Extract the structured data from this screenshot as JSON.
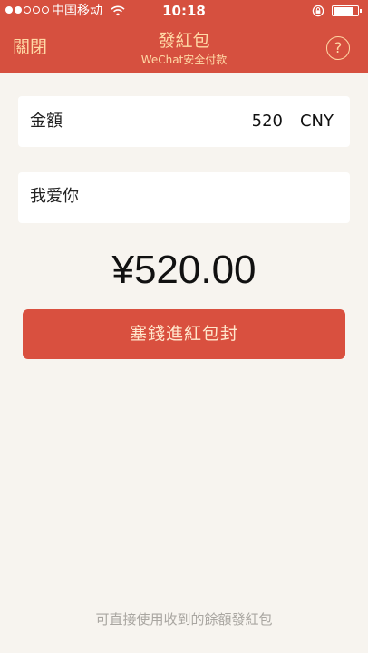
{
  "status_bar": {
    "carrier": "中国移动",
    "time": "10:18",
    "signal_bars_filled": 2,
    "signal_bars_total": 5
  },
  "nav": {
    "close_label": "關閉",
    "title": "發紅包",
    "subtitle": "WeChat安全付款",
    "help_label": "?"
  },
  "amount_row": {
    "label": "金額",
    "value": "520",
    "unit": "CNY"
  },
  "message": {
    "text": "我爱你"
  },
  "display_amount": "¥520.00",
  "submit_label": "塞錢進紅包封",
  "footer_note": "可直接使用收到的餘額發紅包",
  "colors": {
    "header_bg": "#d6503f",
    "button_bg": "#d9503f",
    "header_text": "#ffd9a6",
    "page_bg": "#f7f4ef"
  },
  "icons": [
    "wifi-icon",
    "rotation-lock-icon",
    "battery-icon",
    "help-icon"
  ]
}
